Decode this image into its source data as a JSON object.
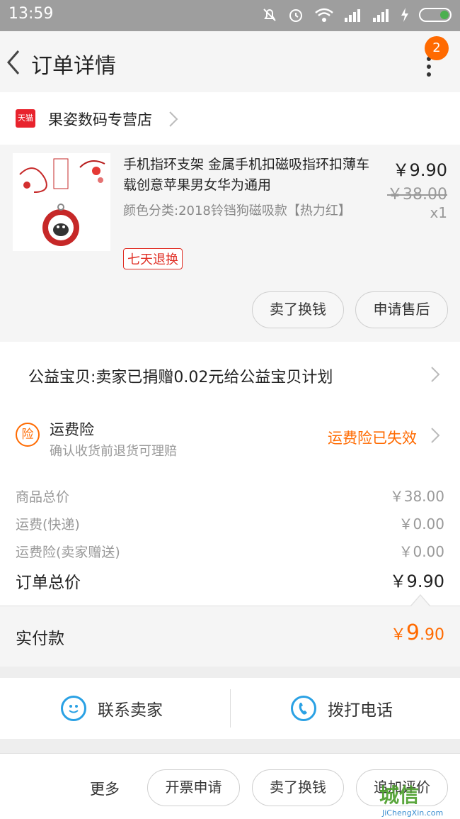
{
  "status_bar": {
    "time": "13:59"
  },
  "header": {
    "title": "订单详情",
    "badge_count": "2"
  },
  "store": {
    "badge": "天猫",
    "name": "果姿数码专营店"
  },
  "product": {
    "title": "手机指环支架 金属手机扣磁吸指环扣薄车载创意苹果男女华为通用",
    "sku": "颜色分类:2018铃铛狗磁吸款【热力红】",
    "tag": "七天退换",
    "price": "￥9.90",
    "original_price": "￥38.00",
    "quantity": "x1",
    "buttons": {
      "sell": "卖了换钱",
      "after_sale": "申请售后"
    }
  },
  "charity": {
    "text": "公益宝贝:卖家已捐赠0.02元给公益宝贝计划"
  },
  "insurance": {
    "icon": "险",
    "title": "运费险",
    "subtitle": "确认收货前退货可理赔",
    "status": "运费险已失效"
  },
  "summary": {
    "rows": [
      {
        "label": "商品总价",
        "value": "￥38.00"
      },
      {
        "label": "运费(快递)",
        "value": "￥0.00"
      },
      {
        "label": "运费险(卖家赠送)",
        "value": "￥0.00"
      }
    ],
    "total_label": "订单总价",
    "total_value": "￥9.90"
  },
  "paid": {
    "label": "实付款",
    "currency": "￥",
    "integer": "9",
    "decimal": ".90"
  },
  "contact": {
    "seller": "联系卖家",
    "call": "拨打电话"
  },
  "bottom_bar": {
    "more": "更多",
    "invoice": "开票申请",
    "sell": "卖了换钱",
    "review": "追加评价"
  },
  "watermark": {
    "main": "城信",
    "sub": "JiChengXin.com"
  },
  "colors": {
    "accent": "#ff6a00",
    "tag_red": "#e02e24",
    "link_blue": "#2aa1e4"
  }
}
